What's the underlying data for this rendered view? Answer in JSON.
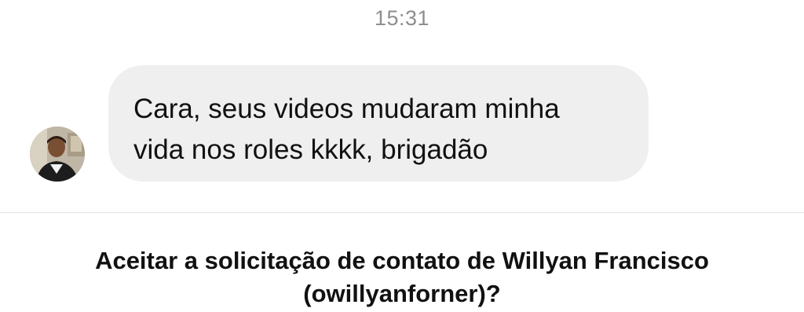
{
  "timestamp": "15:31",
  "message": {
    "sender_avatar_icon": "user-avatar-photo",
    "text": "Cara, seus videos mudaram minha\nvida nos roles kkkk, brigadão"
  },
  "contact_request": {
    "prompt": "Aceitar a solicitação de contato de Willyan Francisco\n(owillyanforner)?"
  },
  "colors": {
    "timestamp": "#8e8e8e",
    "bubble_background": "#efefef",
    "divider": "#e3e3e3",
    "text": "#111111"
  }
}
